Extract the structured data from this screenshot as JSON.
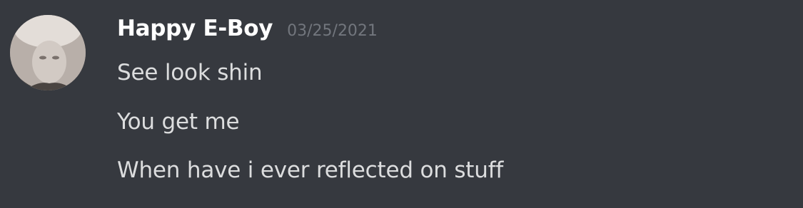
{
  "message": {
    "author": {
      "name": "Happy E-Boy",
      "avatar_icon": "user-avatar-photo"
    },
    "timestamp": "03/25/2021",
    "lines": [
      "See look shin",
      "You get me",
      "When have i ever reflected on stuff"
    ]
  },
  "colors": {
    "background": "#36393f",
    "username": "#ffffff",
    "timestamp": "#72767d",
    "text": "#dcddde"
  }
}
